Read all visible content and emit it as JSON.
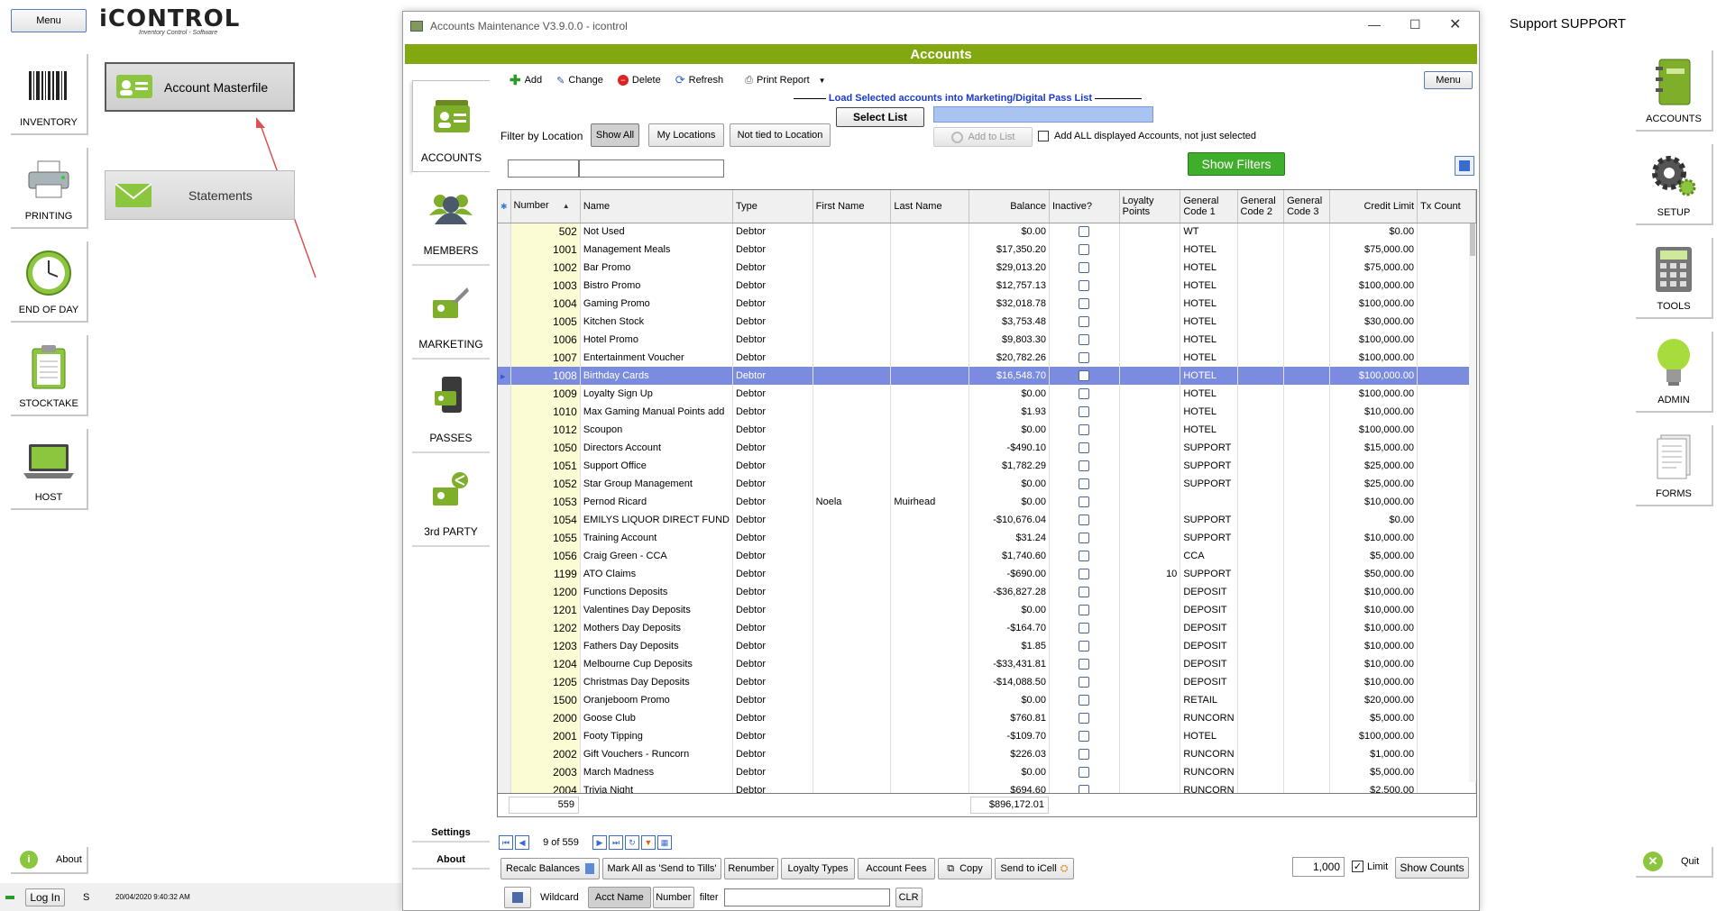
{
  "left_panel": {
    "menu_label": "Menu",
    "logo_text": "iCONTROL",
    "logo_sub": "Inventory Control - Software",
    "nav": [
      {
        "label": "INVENTORY",
        "icon": "barcode-icon"
      },
      {
        "label": "PRINTING",
        "icon": "printer-icon"
      },
      {
        "label": "END OF DAY",
        "icon": "clock-icon"
      },
      {
        "label": "STOCKTAKE",
        "icon": "clipboard-icon"
      },
      {
        "label": "HOST",
        "icon": "laptop-icon"
      }
    ],
    "buttons": {
      "account_masterfile": "Account Masterfile",
      "statements": "Statements"
    },
    "about_label": "About",
    "login_label": "Log In",
    "user_initial": "S",
    "timestamp": "20/04/2020 9:40:32 AM"
  },
  "right_panel": {
    "support_text": "Support SUPPORT",
    "nav": [
      {
        "label": "ACCOUNTS",
        "icon": "notebook-icon"
      },
      {
        "label": "SETUP",
        "icon": "gears-icon"
      },
      {
        "label": "TOOLS",
        "icon": "calculator-icon"
      },
      {
        "label": "ADMIN",
        "icon": "lightbulb-icon"
      },
      {
        "label": "FORMS",
        "icon": "forms-icon"
      }
    ],
    "quit_label": "Quit"
  },
  "window": {
    "title": "Accounts Maintenance V3.9.0.0 - icontrol",
    "header": "Accounts",
    "header_color": "#82a80f",
    "toolbar": {
      "add": "Add",
      "change": "Change",
      "delete": "Delete",
      "refresh": "Refresh",
      "print_report": "Print Report",
      "menu": "Menu"
    },
    "tabs": [
      {
        "label": "ACCOUNTS"
      },
      {
        "label": "MEMBERS"
      },
      {
        "label": "MARKETING"
      },
      {
        "label": "PASSES"
      },
      {
        "label": "3rd PARTY"
      }
    ],
    "settings_label": "Settings",
    "about_label": "About",
    "load_title": "Load Selected accounts into Marketing/Digital Pass List",
    "select_list": "Select List",
    "add_to_list": "Add to List",
    "add_all_label": "Add ALL displayed Accounts, not just selected",
    "filter_label": "Filter by Location",
    "filter_buttons": [
      "Show All",
      "My Locations",
      "Not tied to Location"
    ],
    "show_filters": "Show Filters",
    "columns": [
      "Number",
      "Name",
      "Type",
      "First Name",
      "Last Name",
      "Balance",
      "Inactive?",
      "Loyalty Points",
      "General Code 1",
      "General Code 2",
      "General Code 3",
      "Credit Limit",
      "Tx Count"
    ],
    "rows": [
      {
        "number": "502",
        "name": "Not Used",
        "type": "Debtor",
        "first": "",
        "last": "",
        "balance": "$0.00",
        "loyalty": "",
        "gc1": "WT",
        "credit": "$0.00"
      },
      {
        "number": "1001",
        "name": "Management Meals",
        "type": "Debtor",
        "first": "",
        "last": "",
        "balance": "$17,350.20",
        "loyalty": "",
        "gc1": "HOTEL",
        "credit": "$75,000.00"
      },
      {
        "number": "1002",
        "name": "Bar Promo",
        "type": "Debtor",
        "first": "",
        "last": "",
        "balance": "$29,013.20",
        "loyalty": "",
        "gc1": "HOTEL",
        "credit": "$75,000.00"
      },
      {
        "number": "1003",
        "name": "Bistro Promo",
        "type": "Debtor",
        "first": "",
        "last": "",
        "balance": "$12,757.13",
        "loyalty": "",
        "gc1": "HOTEL",
        "credit": "$100,000.00"
      },
      {
        "number": "1004",
        "name": "Gaming Promo",
        "type": "Debtor",
        "first": "",
        "last": "",
        "balance": "$32,018.78",
        "loyalty": "",
        "gc1": "HOTEL",
        "credit": "$100,000.00"
      },
      {
        "number": "1005",
        "name": "Kitchen Stock",
        "type": "Debtor",
        "first": "",
        "last": "",
        "balance": "$3,753.48",
        "loyalty": "",
        "gc1": "HOTEL",
        "credit": "$30,000.00"
      },
      {
        "number": "1006",
        "name": "Hotel Promo",
        "type": "Debtor",
        "first": "",
        "last": "",
        "balance": "$9,803.30",
        "loyalty": "",
        "gc1": "HOTEL",
        "credit": "$100,000.00"
      },
      {
        "number": "1007",
        "name": "Entertainment Voucher",
        "type": "Debtor",
        "first": "",
        "last": "",
        "balance": "$20,782.26",
        "loyalty": "",
        "gc1": "HOTEL",
        "credit": "$100,000.00"
      },
      {
        "number": "1008",
        "name": "Birthday Cards",
        "type": "Debtor",
        "first": "",
        "last": "",
        "balance": "$16,548.70",
        "loyalty": "",
        "gc1": "HOTEL",
        "credit": "$100,000.00",
        "selected": true
      },
      {
        "number": "1009",
        "name": "Loyalty Sign Up",
        "type": "Debtor",
        "first": "",
        "last": "",
        "balance": "$0.00",
        "loyalty": "",
        "gc1": "HOTEL",
        "credit": "$100,000.00"
      },
      {
        "number": "1010",
        "name": "Max Gaming Manual Points add",
        "type": "Debtor",
        "first": "",
        "last": "",
        "balance": "$1.93",
        "loyalty": "",
        "gc1": "HOTEL",
        "credit": "$10,000.00"
      },
      {
        "number": "1012",
        "name": "Scoupon",
        "type": "Debtor",
        "first": "",
        "last": "",
        "balance": "$0.00",
        "loyalty": "",
        "gc1": "HOTEL",
        "credit": "$100,000.00"
      },
      {
        "number": "1050",
        "name": "Directors Account",
        "type": "Debtor",
        "first": "",
        "last": "",
        "balance": "-$490.10",
        "loyalty": "",
        "gc1": "SUPPORT",
        "credit": "$15,000.00"
      },
      {
        "number": "1051",
        "name": "Support Office",
        "type": "Debtor",
        "first": "",
        "last": "",
        "balance": "$1,782.29",
        "loyalty": "",
        "gc1": "SUPPORT",
        "credit": "$25,000.00"
      },
      {
        "number": "1052",
        "name": "Star Group Management",
        "type": "Debtor",
        "first": "",
        "last": "",
        "balance": "$0.00",
        "loyalty": "",
        "gc1": "SUPPORT",
        "credit": "$25,000.00"
      },
      {
        "number": "1053",
        "name": "Pernod Ricard",
        "type": "Debtor",
        "first": "Noela",
        "last": "Muirhead",
        "balance": "$0.00",
        "loyalty": "",
        "gc1": "",
        "credit": "$10,000.00"
      },
      {
        "number": "1054",
        "name": "EMILYS LIQUOR DIRECT FUND",
        "type": "Debtor",
        "first": "",
        "last": "",
        "balance": "-$10,676.04",
        "loyalty": "",
        "gc1": "SUPPORT",
        "credit": "$0.00"
      },
      {
        "number": "1055",
        "name": "Training Account",
        "type": "Debtor",
        "first": "",
        "last": "",
        "balance": "$31.24",
        "loyalty": "",
        "gc1": "SUPPORT",
        "credit": "$10,000.00"
      },
      {
        "number": "1056",
        "name": "Craig Green - CCA",
        "type": "Debtor",
        "first": "",
        "last": "",
        "balance": "$1,740.60",
        "loyalty": "",
        "gc1": "CCA",
        "credit": "$5,000.00"
      },
      {
        "number": "1199",
        "name": "ATO Claims",
        "type": "Debtor",
        "first": "",
        "last": "",
        "balance": "-$690.00",
        "loyalty": "10",
        "gc1": "SUPPORT",
        "credit": "$50,000.00"
      },
      {
        "number": "1200",
        "name": "Functions Deposits",
        "type": "Debtor",
        "first": "",
        "last": "",
        "balance": "-$36,827.28",
        "loyalty": "",
        "gc1": "DEPOSIT",
        "credit": "$10,000.00"
      },
      {
        "number": "1201",
        "name": "Valentines Day Deposits",
        "type": "Debtor",
        "first": "",
        "last": "",
        "balance": "$0.00",
        "loyalty": "",
        "gc1": "DEPOSIT",
        "credit": "$10,000.00"
      },
      {
        "number": "1202",
        "name": "Mothers Day Deposits",
        "type": "Debtor",
        "first": "",
        "last": "",
        "balance": "-$164.70",
        "loyalty": "",
        "gc1": "DEPOSIT",
        "credit": "$10,000.00"
      },
      {
        "number": "1203",
        "name": "Fathers Day Deposits",
        "type": "Debtor",
        "first": "",
        "last": "",
        "balance": "$1.85",
        "loyalty": "",
        "gc1": "DEPOSIT",
        "credit": "$10,000.00"
      },
      {
        "number": "1204",
        "name": "Melbourne Cup Deposits",
        "type": "Debtor",
        "first": "",
        "last": "",
        "balance": "-$33,431.81",
        "loyalty": "",
        "gc1": "DEPOSIT",
        "credit": "$10,000.00"
      },
      {
        "number": "1205",
        "name": "Christmas Day Deposits",
        "type": "Debtor",
        "first": "",
        "last": "",
        "balance": "-$14,088.50",
        "loyalty": "",
        "gc1": "DEPOSIT",
        "credit": "$10,000.00"
      },
      {
        "number": "1500",
        "name": "Oranjeboom Promo",
        "type": "Debtor",
        "first": "",
        "last": "",
        "balance": "$0.00",
        "loyalty": "",
        "gc1": "RETAIL",
        "credit": "$20,000.00"
      },
      {
        "number": "2000",
        "name": "Goose Club",
        "type": "Debtor",
        "first": "",
        "last": "",
        "balance": "$760.81",
        "loyalty": "",
        "gc1": "RUNCORN",
        "credit": "$5,000.00"
      },
      {
        "number": "2001",
        "name": "Footy Tipping",
        "type": "Debtor",
        "first": "",
        "last": "",
        "balance": "-$109.70",
        "loyalty": "",
        "gc1": "HOTEL",
        "credit": "$100,000.00"
      },
      {
        "number": "2002",
        "name": "Gift Vouchers - Runcorn",
        "type": "Debtor",
        "first": "",
        "last": "",
        "balance": "$226.03",
        "loyalty": "",
        "gc1": "RUNCORN",
        "credit": "$1,000.00"
      },
      {
        "number": "2003",
        "name": "March Madness",
        "type": "Debtor",
        "first": "",
        "last": "",
        "balance": "$0.00",
        "loyalty": "",
        "gc1": "RUNCORN",
        "credit": "$5,000.00"
      },
      {
        "number": "2004",
        "name": "Trivia Night",
        "type": "Debtor",
        "first": "",
        "last": "",
        "balance": "$694.60",
        "loyalty": "",
        "gc1": "RUNCORN",
        "credit": "$2,500.00"
      }
    ],
    "footer_count": "559",
    "footer_balance": "$896,172.01",
    "nav_position": "9 of 559",
    "bottom_buttons": {
      "recalc": "Recalc Balances",
      "mark_all": "Mark All as 'Send to Tills'",
      "renumber": "Renumber",
      "loyalty_types": "Loyalty Types",
      "account_fees": "Account Fees",
      "copy": "Copy",
      "send_icell": "Send to iCell"
    },
    "limit_value": "1,000",
    "limit_label": "Limit",
    "show_counts": "Show Counts",
    "wildcard": "Wildcard",
    "acct_name": "Acct Name",
    "number_btn": "Number",
    "filter_label2": "filter",
    "clr": "CLR"
  },
  "colors": {
    "selected_row": "#7b8ce0",
    "number_cell": "#fbfbd4",
    "show_filters_bg": "#3fae2a"
  }
}
